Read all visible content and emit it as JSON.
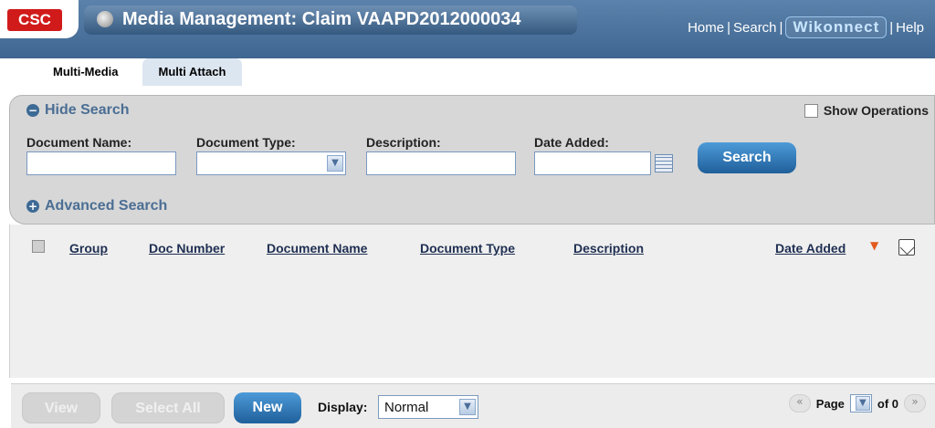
{
  "header": {
    "logo": "CSC",
    "title": "Media Management: Claim VAAPD2012000034",
    "links": [
      "Home",
      "Search",
      "Wikonnect",
      "Help"
    ]
  },
  "tabs": [
    {
      "label": "Multi-Media",
      "active": true
    },
    {
      "label": "Multi Attach",
      "active": false
    }
  ],
  "search": {
    "hide_label": "Hide Search",
    "show_operations_label": "Show Operations",
    "fields": [
      {
        "label": "Document Name:",
        "value": ""
      },
      {
        "label": "Document Type:",
        "value": ""
      },
      {
        "label": "Description:",
        "value": ""
      },
      {
        "label": "Date Added:",
        "value": ""
      }
    ],
    "search_button": "Search",
    "advanced_label": "Advanced Search"
  },
  "grid": {
    "columns": [
      "Group",
      "Doc Number",
      "Document Name",
      "Document Type",
      "Description",
      "Date Added"
    ]
  },
  "footer": {
    "buttons": [
      "View",
      "Select All",
      "New"
    ],
    "display_label": "Display:",
    "display_value": "Normal",
    "page_label": "Page",
    "page_of": "of 0"
  },
  "colors": {
    "header_bg": "#4a739c",
    "panel_bg": "#d7d7d7",
    "grid_bg": "#efefef",
    "button_blue": "#2f78b9",
    "link_text": "#1f2f52"
  }
}
